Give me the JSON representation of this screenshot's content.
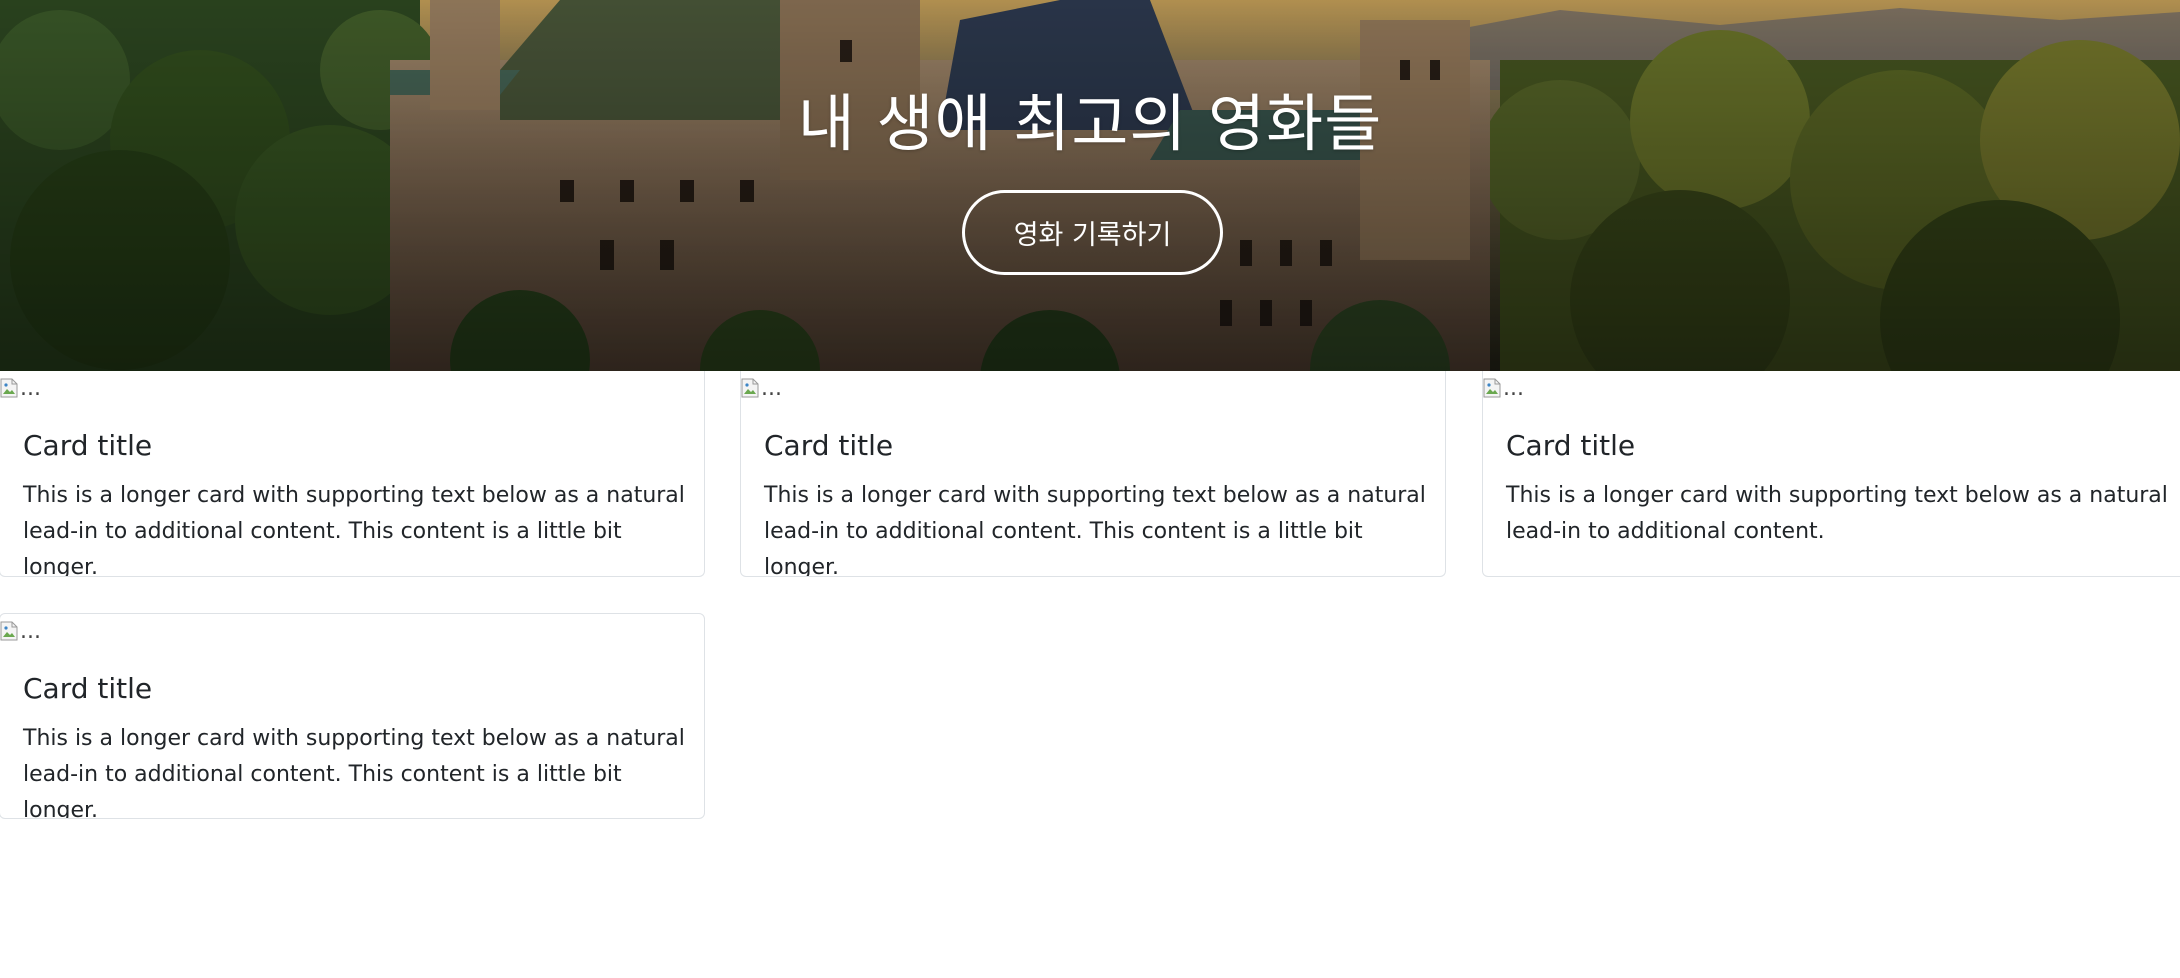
{
  "hero": {
    "title": "내 생애 최고의 영화들",
    "button_label": "영화 기록하기"
  },
  "cards": [
    {
      "image_alt": "...",
      "title": "Card title",
      "text": "This is a longer card with supporting text below as a natural lead-in to additional content. This content is a little bit longer."
    },
    {
      "image_alt": "...",
      "title": "Card title",
      "text": "This is a longer card with supporting text below as a natural lead-in to additional content. This content is a little bit longer."
    },
    {
      "image_alt": "...",
      "title": "Card title",
      "text": "This is a longer card with supporting text below as a natural lead-in to additional content."
    },
    {
      "image_alt": "...",
      "title": "Card title",
      "text": "This is a longer card with supporting text below as a natural lead-in to additional content. This content is a little bit longer."
    }
  ],
  "colors": {
    "hero_text": "#ffffff",
    "card_border": "#dee2e6",
    "body_text": "#212529"
  },
  "icons": {
    "broken_image": "broken-image-icon"
  }
}
